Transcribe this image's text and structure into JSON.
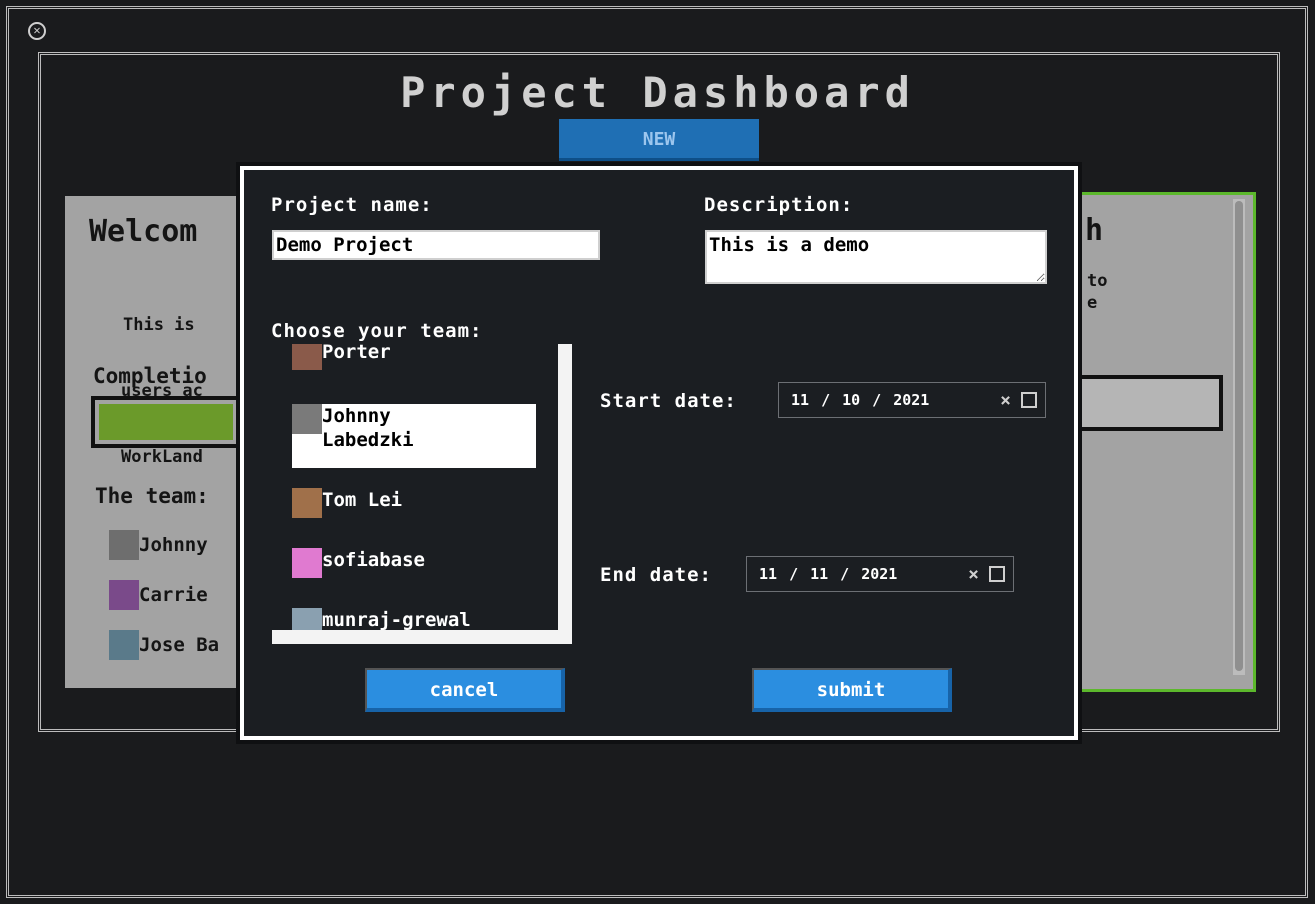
{
  "app": {
    "close_symbol": "✕"
  },
  "dashboard": {
    "title": "Project Dashboard",
    "new_button_label": "NEW"
  },
  "left_card": {
    "welcome": "Welcom",
    "intro_lines": [
      "This is",
      "users ac",
      "WorkLand"
    ],
    "completion_label": "Completio",
    "completion_progress": 0.55,
    "team_label": "The team:",
    "members": [
      {
        "name": "Johnny",
        "avatar_color": "#6e6e6e"
      },
      {
        "name": "Carrie",
        "avatar_color": "#7a4a8a"
      },
      {
        "name": "Jose Ba",
        "avatar_color": "#5a7a8a"
      }
    ]
  },
  "right_card": {
    "heading": "h",
    "line1": "to",
    "line2": "e",
    "border_color": "#5cb82c"
  },
  "modal": {
    "project_name_label": "Project name:",
    "project_name_value": "Demo Project",
    "description_label": "Description:",
    "description_value": "This is a demo",
    "team_label": "Choose your team:",
    "team_options": [
      {
        "name": "Porter",
        "avatar_color": "#8a5a4a",
        "selected": false
      },
      {
        "name": "Johnny Labedzki",
        "avatar_color": "#7a7a7a",
        "selected": true
      },
      {
        "name": "Tom Lei",
        "avatar_color": "#a0704a",
        "selected": false
      },
      {
        "name": "sofiabase",
        "avatar_color": "#e07ad0",
        "selected": false
      },
      {
        "name": "munraj-grewal",
        "avatar_color": "#8aa0b0",
        "selected": false
      }
    ],
    "start_date_label": "Start date:",
    "start_date": {
      "month": "11",
      "day": "10",
      "year": "2021"
    },
    "end_date_label": "End date:",
    "end_date": {
      "month": "11",
      "day": "11",
      "year": "2021"
    },
    "date_separator": "/",
    "clear_symbol": "×",
    "cancel_label": "cancel",
    "submit_label": "submit"
  },
  "colors": {
    "background": "#1a1b1d",
    "modal_bg": "#1b1e22",
    "accent_blue": "#2b8ee0",
    "new_button_blue": "#1f6fb4",
    "progress_green": "#6b9a2a"
  }
}
